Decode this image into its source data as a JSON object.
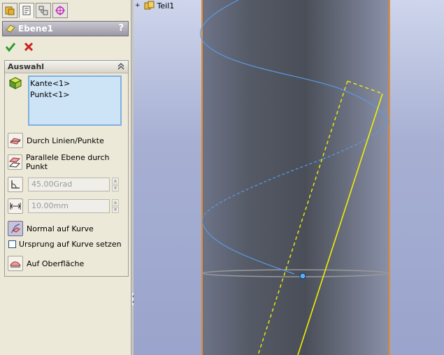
{
  "tabs": [
    {
      "name": "feature-manager"
    },
    {
      "name": "property-manager"
    },
    {
      "name": "configuration-manager"
    },
    {
      "name": "dimxpert-manager"
    }
  ],
  "feature": {
    "title": "Ebene1",
    "help": "?"
  },
  "selection": {
    "group_label": "Auswahl",
    "items": [
      "Kante<1>",
      "Punkt<1>"
    ]
  },
  "options": {
    "through_lines_points": "Durch Linien/Punkte",
    "parallel_plane": "Parallele Ebene durch Punkt",
    "angle_value": "45.00Grad",
    "distance_value": "10.00mm",
    "normal_to_curve": "Normal auf Kurve",
    "origin_on_curve": "Ursprung auf Kurve setzen",
    "on_surface": "Auf Oberfläche"
  },
  "tree": {
    "expander": "+",
    "root": "Teil1"
  },
  "colors": {
    "plane_outline": "#f0f000",
    "helix": "#5a9be6",
    "cylinder_edge": "#e58a2e"
  }
}
